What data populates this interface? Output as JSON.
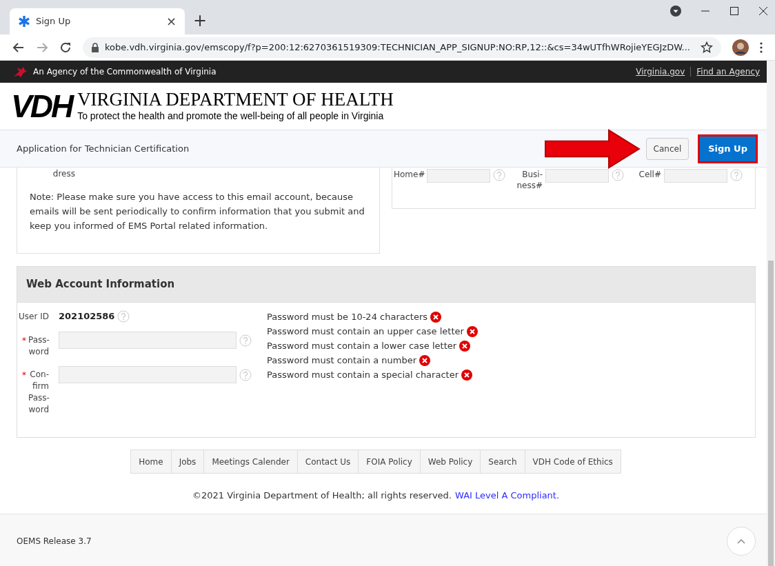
{
  "browser": {
    "tab": {
      "title": "Sign Up",
      "close": "×"
    },
    "new_tab": "+",
    "url": "kobe.vdh.virginia.gov/emscopy/f?p=200:12:6270361519309:TECHNICIAN_APP_SIGNUP:NO:RP,12::&cs=34wUTfhWRojieYEGJzDW..."
  },
  "agency_bar": {
    "text": "An Agency of the Commonwealth of Virginia",
    "links": [
      "Virginia.gov",
      "Find an Agency"
    ]
  },
  "header": {
    "logo": "VDH",
    "title": "VIRGINIA DEPARTMENT OF HEALTH",
    "tagline": "To protect the health and promote the well-being of all people in Virginia"
  },
  "page_bar": {
    "title": "Application for Technician Certification",
    "buttons": [
      {
        "label": "Cancel",
        "kind": "secondary"
      },
      {
        "label": "Sign Up",
        "kind": "primary"
      }
    ]
  },
  "email_card": {
    "label": "dress",
    "note": "Note: Please make sure you have access to this email account, because emails will be sent periodically to confirm information that you submit and keep you informed of EMS Portal related information."
  },
  "phone_card": {
    "fields": [
      {
        "label": "Home#"
      },
      {
        "label": "Busi-ness#"
      },
      {
        "label": "Cell#"
      }
    ]
  },
  "web_account": {
    "title": "Web Account Information",
    "user_id_label": "User ID",
    "user_id": "202102586",
    "fields": [
      {
        "label": "Pass-word",
        "required_mark": "*"
      },
      {
        "label": "Con-firm Pass-word",
        "required_mark": "*"
      }
    ],
    "rules": [
      {
        "text": "Password must be 10-24 characters",
        "met": false
      },
      {
        "text": "Password must contain an upper case letter",
        "met": false
      },
      {
        "text": "Password must contain a lower case letter",
        "met": false
      },
      {
        "text": "Password must contain a number",
        "met": false
      },
      {
        "text": "Password must contain a special character",
        "met": false
      }
    ]
  },
  "footer_links": [
    "Home",
    "Jobs",
    "Meetings Calender",
    "Contact Us",
    "FOIA Policy",
    "Web Policy",
    "Search",
    "VDH Code of Ethics"
  ],
  "copyright": {
    "text": "©2021 Virginia Department of Health; all rights reserved.",
    "link": "WAI Level A Compliant."
  },
  "release": "OEMS Release 3.7"
}
